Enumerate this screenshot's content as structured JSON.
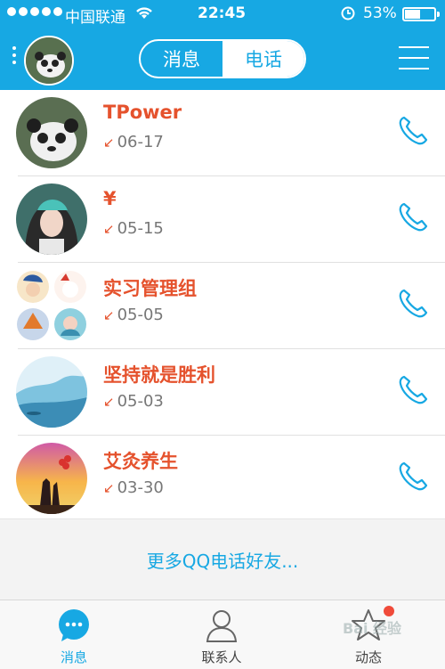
{
  "status_bar": {
    "carrier": "中国联通",
    "time": "22:45",
    "battery": "53%"
  },
  "header": {
    "tabs": [
      {
        "label": "消息",
        "active": false
      },
      {
        "label": "电话",
        "active": true
      }
    ]
  },
  "calls": [
    {
      "name": "TPower",
      "date": "06-17"
    },
    {
      "name": "¥",
      "date": "05-15"
    },
    {
      "name": "实习管理组",
      "date": "05-05"
    },
    {
      "name": "坚持就是胜利",
      "date": "05-03"
    },
    {
      "name": "艾灸养生",
      "date": "03-30"
    }
  ],
  "more_link": "更多QQ电话好友...",
  "tab_bar": {
    "items": [
      {
        "label": "消息",
        "icon": "chat-bubble-icon",
        "active": true
      },
      {
        "label": "联系人",
        "icon": "contacts-icon",
        "active": false
      },
      {
        "label": "动态",
        "icon": "star-icon",
        "active": false
      }
    ]
  },
  "watermark": "Bai 经验",
  "colors": {
    "accent": "#17a8e3",
    "name": "#e5522d",
    "badge": "#f04b3a"
  }
}
